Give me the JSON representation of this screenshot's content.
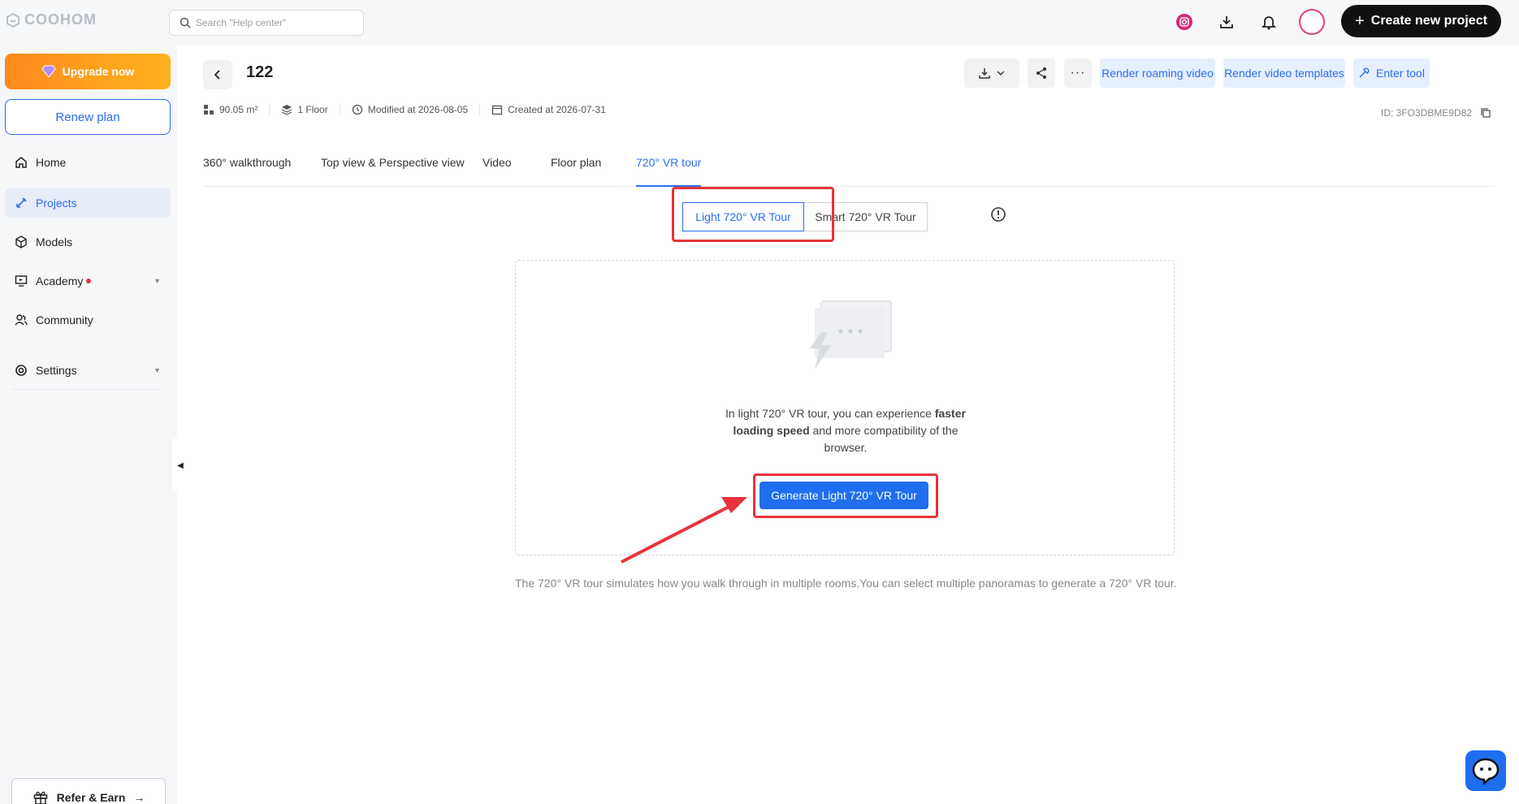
{
  "app": {
    "logo_text": "COOHOM"
  },
  "search": {
    "placeholder": "Search \"Help center\""
  },
  "header": {
    "create_label": "Create new project"
  },
  "sidebar": {
    "upgrade_label": "Upgrade now",
    "renew_label": "Renew plan",
    "items": [
      {
        "label": "Home",
        "icon": "home-icon"
      },
      {
        "label": "Projects",
        "icon": "projects-icon"
      },
      {
        "label": "Models",
        "icon": "cube-icon"
      },
      {
        "label": "Academy",
        "icon": "monitor-icon"
      },
      {
        "label": "Community",
        "icon": "people-icon"
      },
      {
        "label": "Settings",
        "icon": "gear-icon"
      }
    ],
    "refer_label": "Refer & Earn"
  },
  "project": {
    "title": "122",
    "area": "90.05 m²",
    "floors": "1 Floor",
    "modified": "Modified at 2026-08-05",
    "created": "Created at 2026-07-31",
    "id": "ID: 3FO3DBME9D82"
  },
  "toolbar": {
    "render_roaming": "Render roaming video",
    "render_templates": "Render video templates",
    "enter_tool": "Enter tool"
  },
  "tabs": [
    {
      "label": "360° walkthrough"
    },
    {
      "label": "Top view & Perspective view"
    },
    {
      "label": "Video"
    },
    {
      "label": "Floor plan"
    },
    {
      "label": "720° VR tour"
    }
  ],
  "vr": {
    "light_label": "Light 720° VR Tour",
    "smart_label": "Smart 720° VR Tour",
    "desc_1": "In light 720° VR tour, you can experience ",
    "desc_bold": "faster loading speed",
    "desc_2": " and more compatibility of the browser.",
    "generate_label": "Generate Light 720° VR Tour",
    "footnote": "The 720° VR tour simulates how you walk through in multiple rooms.You can select multiple panoramas to generate a 720° VR tour."
  },
  "colors": {
    "accent": "#2a6df4",
    "highlight": "#e8333a",
    "upgrade": "#ff9a1f"
  }
}
